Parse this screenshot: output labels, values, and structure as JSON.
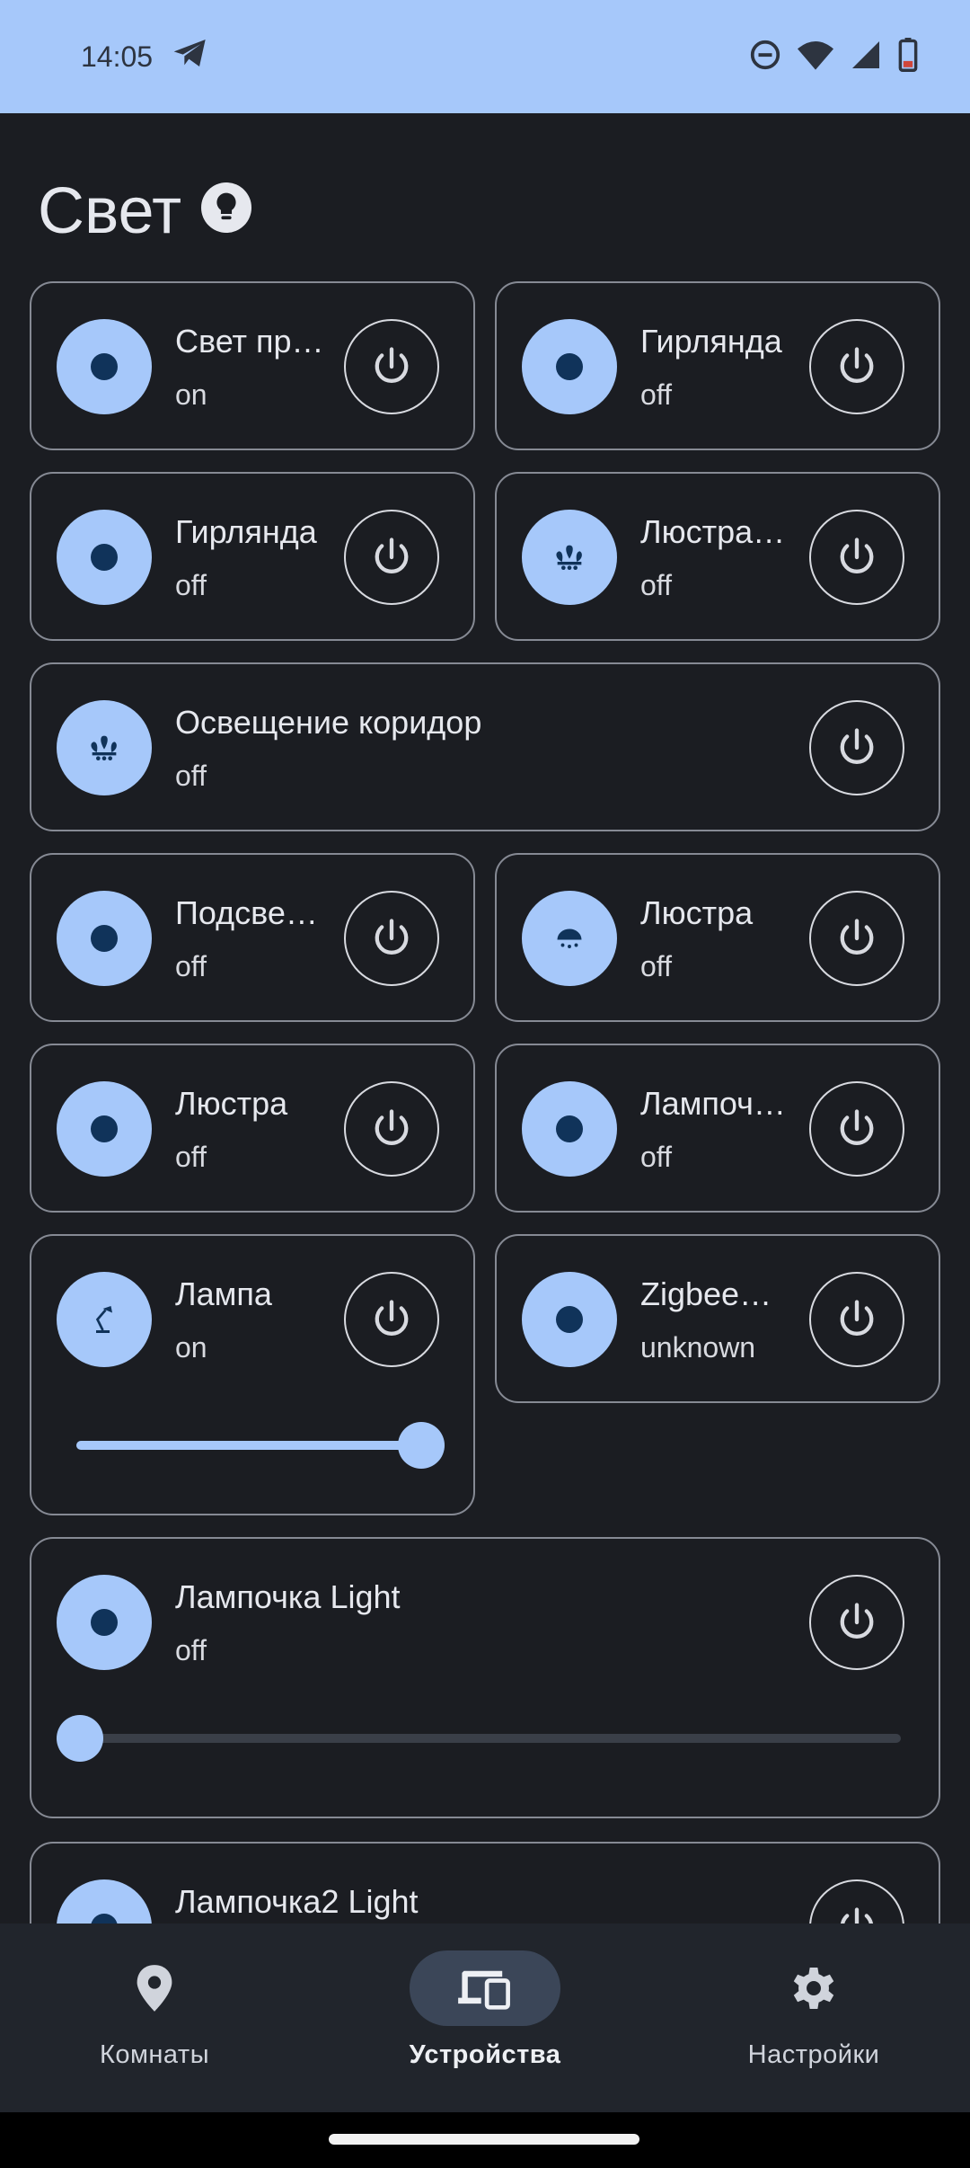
{
  "status_bar": {
    "time": "14:05"
  },
  "page": {
    "title": "Свет"
  },
  "devices": [
    {
      "name": "Свет пр…",
      "state": "on",
      "icon": "dot"
    },
    {
      "name": "Гирлянда",
      "state": "off",
      "icon": "dot"
    },
    {
      "name": "Гирлянда",
      "state": "off",
      "icon": "dot"
    },
    {
      "name": "Люстра…",
      "state": "off",
      "icon": "chandelier"
    },
    {
      "name": "Освещение коридор",
      "state": "off",
      "icon": "chandelier"
    },
    {
      "name": "Подсве…",
      "state": "off",
      "icon": "dot"
    },
    {
      "name": "Люстра",
      "state": "off",
      "icon": "ceiling-light"
    },
    {
      "name": "Люстра",
      "state": "off",
      "icon": "dot"
    },
    {
      "name": "Лампоч…",
      "state": "off",
      "icon": "dot"
    },
    {
      "name": "Лампа",
      "state": "on",
      "icon": "desk-lamp",
      "brightness_percent": 100
    },
    {
      "name": "ZigbeeS…",
      "state": "unknown",
      "icon": "dot"
    },
    {
      "name": "Лампочка Light",
      "state": "off",
      "icon": "dot",
      "brightness_percent": 0
    },
    {
      "name": "Лампочка2 Light",
      "state": "",
      "icon": "dot"
    }
  ],
  "bottom_nav": [
    {
      "label": "Комнаты",
      "icon": "location-pin-icon",
      "active": false
    },
    {
      "label": "Устройства",
      "icon": "devices-icon",
      "active": true
    },
    {
      "label": "Настройки",
      "icon": "gear-icon",
      "active": false
    }
  ],
  "colors": {
    "accent": "#a6c8fa",
    "background": "#1b1d22",
    "status_bar": "#a6c8fa"
  }
}
